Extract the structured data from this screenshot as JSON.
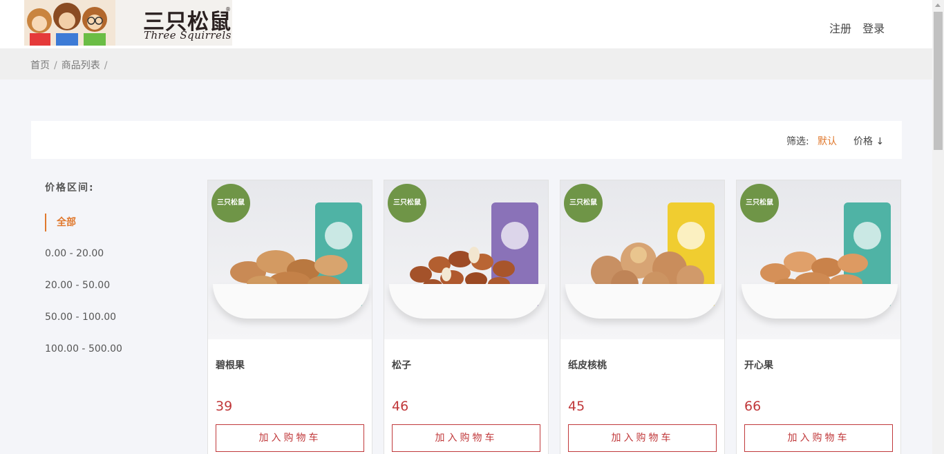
{
  "header": {
    "logo_cn": "三只松鼠",
    "logo_en": "Three Squirrels",
    "logo_reg": "®",
    "links": [
      "注册",
      "登录"
    ]
  },
  "breadcrumb": [
    "首页",
    "商品列表"
  ],
  "breadcrumb_sep": "/",
  "filter": {
    "label": "筛选:",
    "default": "默认",
    "price": "价格 ↓"
  },
  "sidebar": {
    "title": "价格区间:",
    "ranges": [
      "全部",
      "0.00 - 20.00",
      "20.00 - 50.00",
      "50.00 - 100.00",
      "100.00 - 500.00"
    ],
    "active_index": 0
  },
  "products": [
    {
      "name": "碧根果",
      "price": "39",
      "cart_label": "加入购物车",
      "bag_color": "#4fb3a5"
    },
    {
      "name": "松子",
      "price": "46",
      "cart_label": "加入购物车",
      "bag_color": "#8a72b8"
    },
    {
      "name": "纸皮核桃",
      "price": "45",
      "cart_label": "加入购物车",
      "bag_color": "#f0cd30"
    },
    {
      "name": "开心果",
      "price": "66",
      "cart_label": "加入购物车",
      "bag_color": "#4fb3a5"
    }
  ],
  "colors": {
    "accent": "#e0782d",
    "price": "#c0383a",
    "badge": "#6f9547",
    "nut": "#c98a55"
  }
}
